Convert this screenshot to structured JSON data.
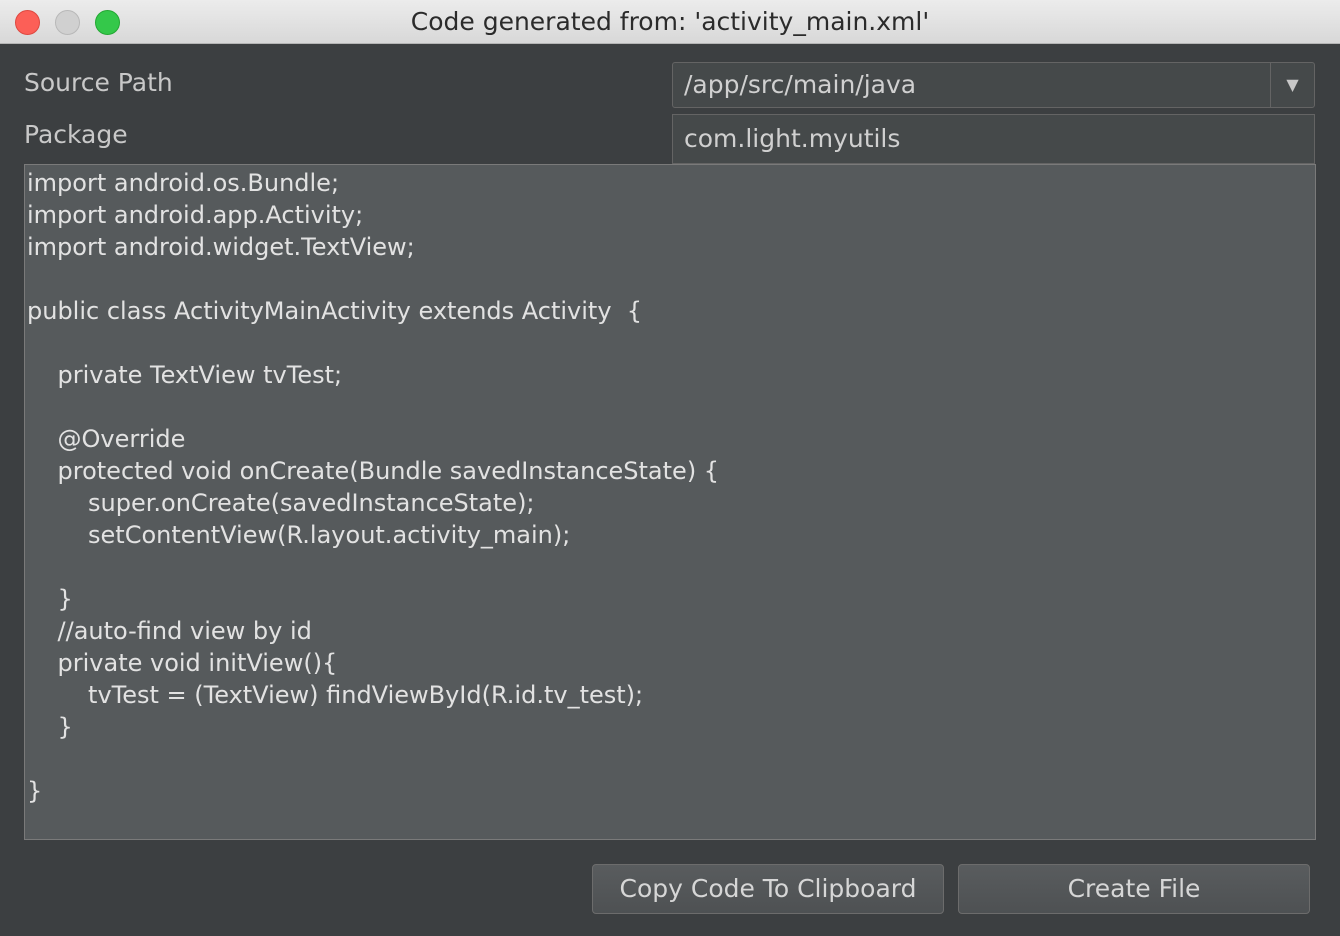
{
  "window": {
    "title": "Code generated from: 'activity_main.xml'",
    "controls": [
      "close",
      "minimize",
      "zoom"
    ]
  },
  "form": {
    "source_path_label": "Source Path",
    "source_path_value": "/app/src/main/java",
    "package_label": "Package",
    "package_value": "com.light.myutils"
  },
  "code": {
    "text": "import android.os.Bundle;\nimport android.app.Activity;\nimport android.widget.TextView;\n\npublic class ActivityMainActivity extends Activity  {\n\n    private TextView tvTest;\n\n    @Override\n    protected void onCreate(Bundle savedInstanceState) {\n        super.onCreate(savedInstanceState);\n        setContentView(R.layout.activity_main);\n\n    }\n    //auto-find view by id\n    private void initView(){\n        tvTest = (TextView) findViewById(R.id.tv_test);\n    }\n\n}"
  },
  "buttons": {
    "copy_label": "Copy Code To Clipboard",
    "create_label": "Create File"
  },
  "icons": {
    "dropdown": "chevron-down-icon"
  },
  "colors": {
    "background": "#3c3f41",
    "code_background": "#565a5c",
    "text": "#c8c8c8",
    "close": "#fc5f57",
    "zoom": "#34c84a"
  }
}
